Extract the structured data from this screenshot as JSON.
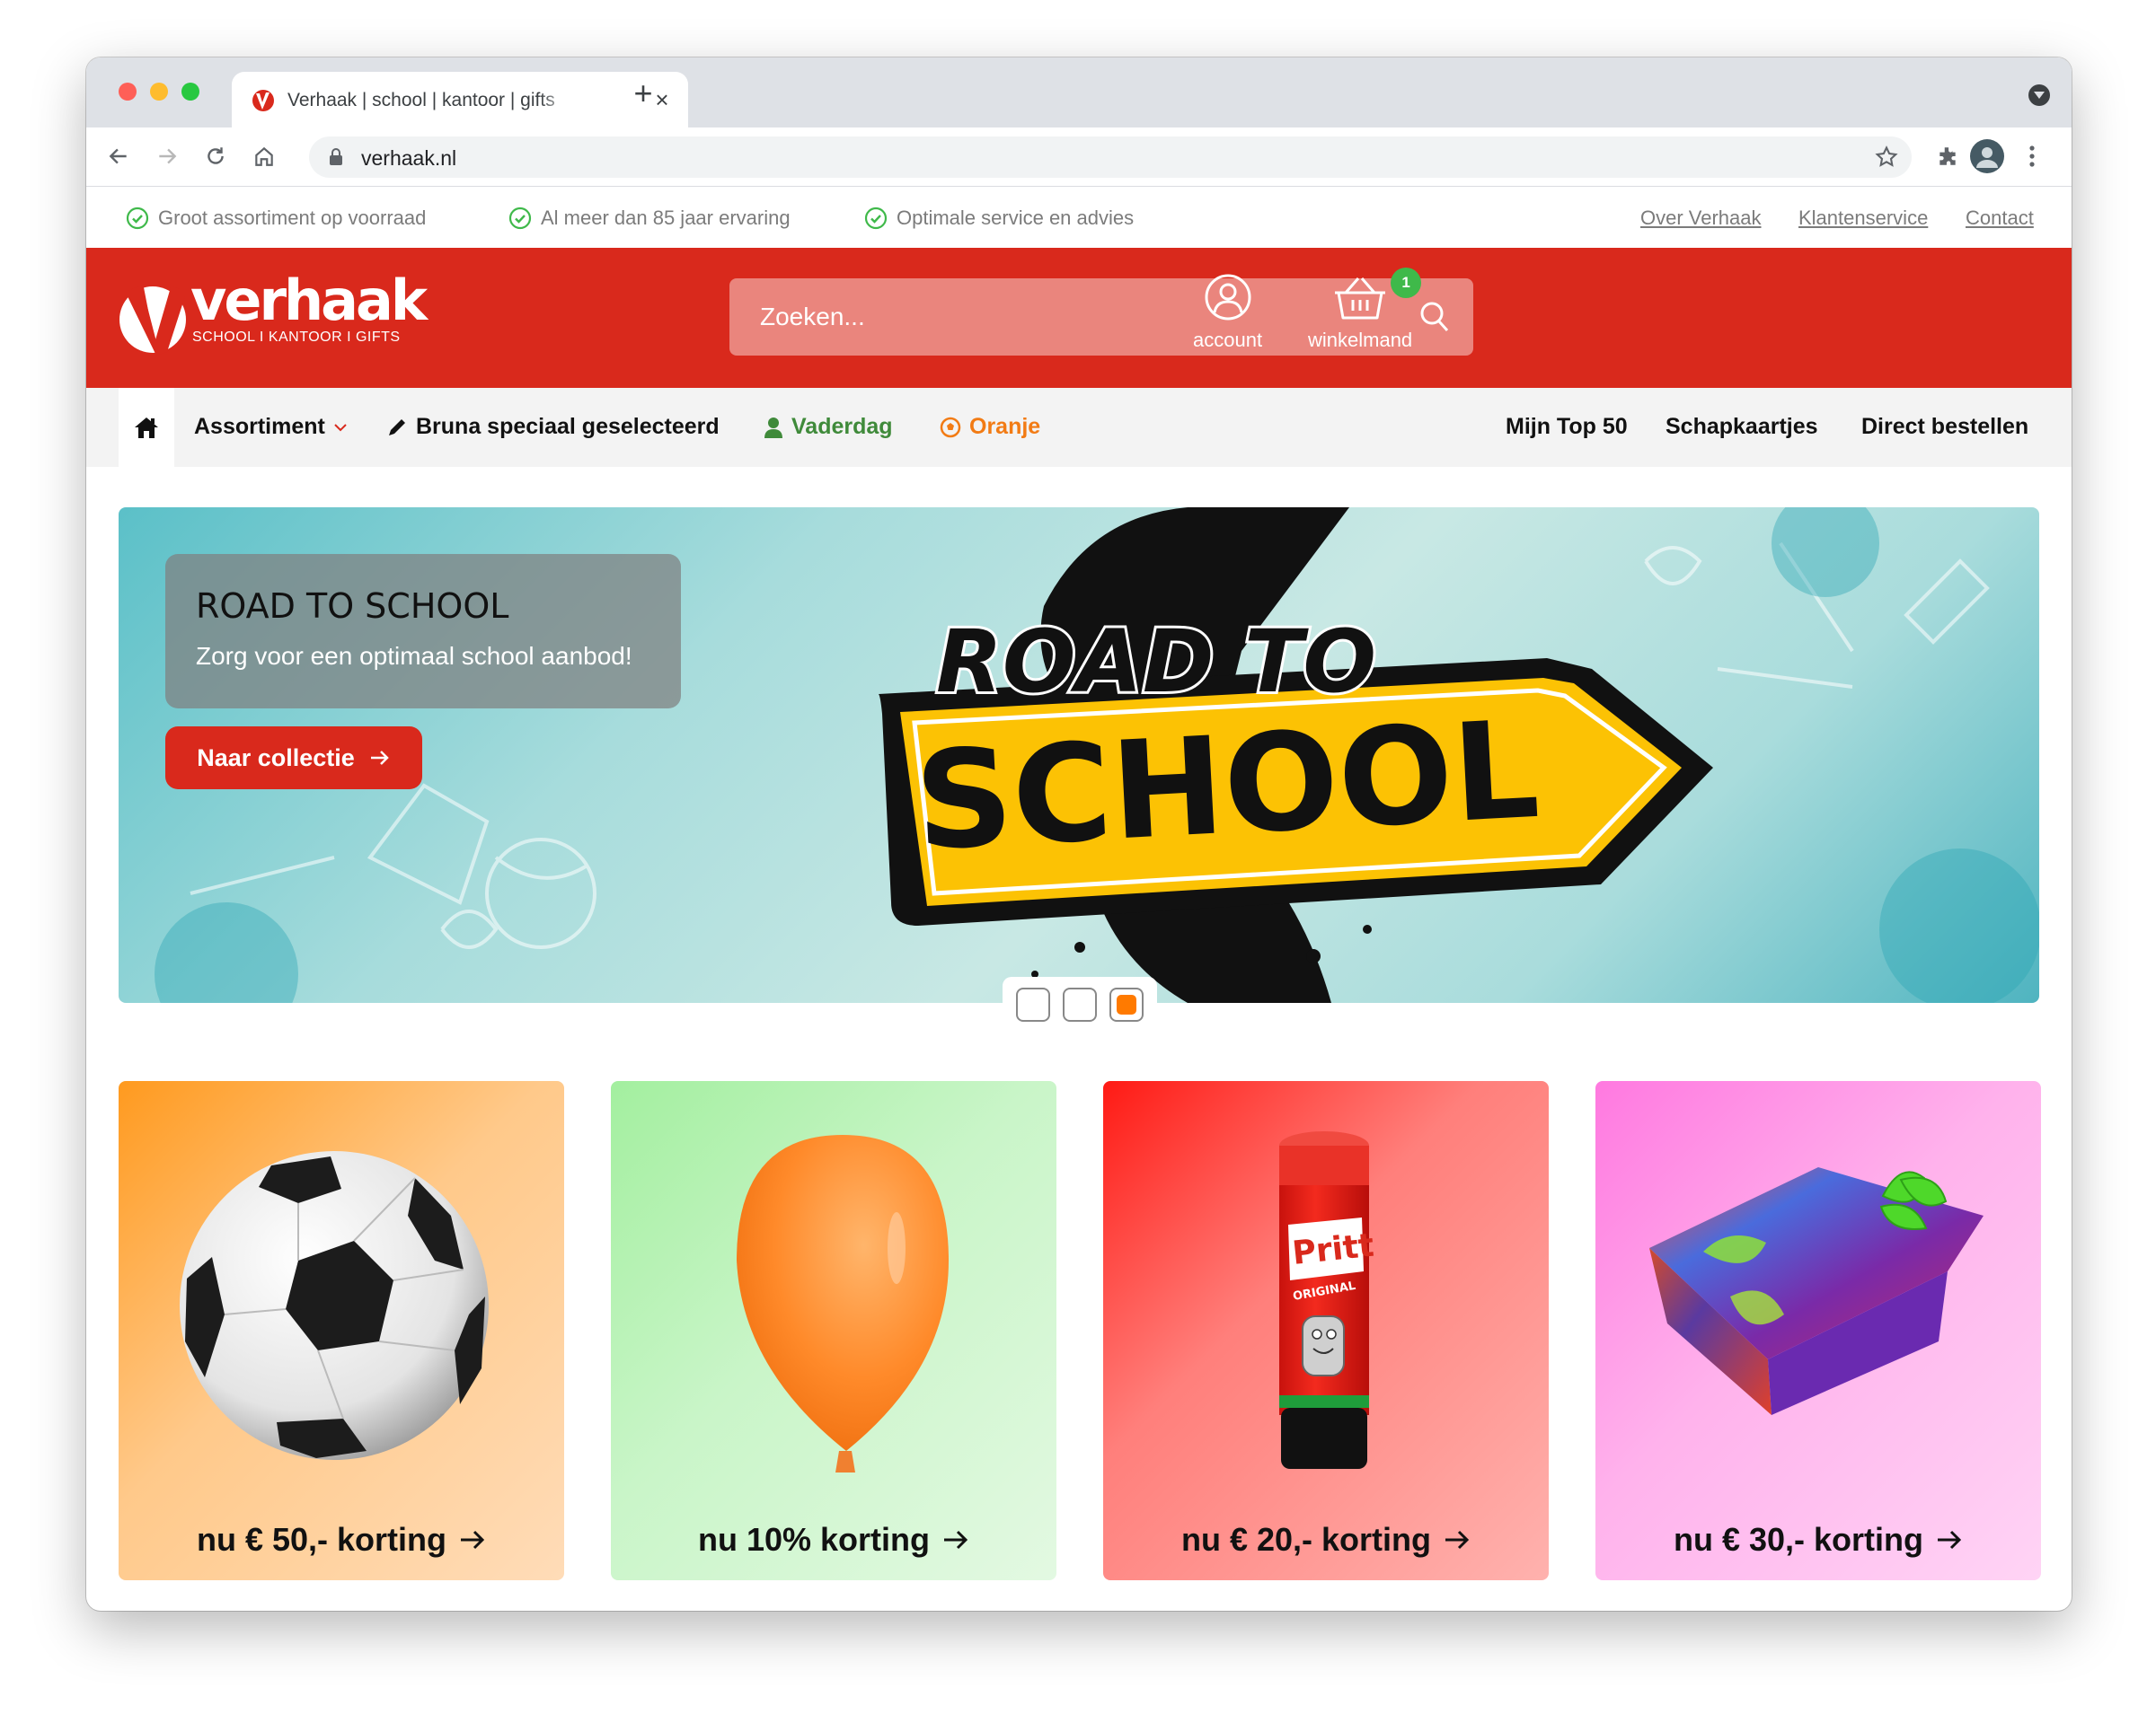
{
  "browser": {
    "tab_title": "Verhaak | school | kantoor | gifts",
    "url": "verhaak.nl",
    "icons": [
      "back-icon",
      "forward-icon",
      "reload-icon",
      "home-icon",
      "lock-icon",
      "star-icon",
      "extensions-icon",
      "profile-icon",
      "menu-icon",
      "tab-overflow-icon"
    ]
  },
  "usp_bar": {
    "items": [
      {
        "icon": "check-circle-icon",
        "text": "Groot assortiment op voorraad"
      },
      {
        "icon": "check-circle-icon",
        "text": "Al meer dan 85 jaar ervaring"
      },
      {
        "icon": "check-circle-icon",
        "text": "Optimale service en advies"
      }
    ],
    "links": [
      "Over Verhaak",
      "Klantenservice",
      "Contact"
    ]
  },
  "header": {
    "logo_word": "verhaak",
    "logo_tagline": "SCHOOL I KANTOOR I GIFTS",
    "search_placeholder": "Zoeken...",
    "account_label": "account",
    "cart_label": "winkelmand",
    "cart_count": "1",
    "brand_color": "#d9291c"
  },
  "nav": {
    "home_icon": "home-icon",
    "items": [
      {
        "label": "Assortiment",
        "icon": "chevron-down-icon"
      },
      {
        "label": "Bruna speciaal geselecteerd",
        "icon": "pencil-icon"
      },
      {
        "label": "Vaderdag",
        "icon": "user-icon",
        "color": "#3f8a3a"
      },
      {
        "label": "Oranje",
        "icon": "soccer-ball-icon",
        "color": "#f27b14"
      }
    ],
    "right_items": [
      "Mijn Top 50",
      "Schapkaartjes",
      "Direct bestellen"
    ]
  },
  "hero": {
    "title": "ROAD TO SCHOOL",
    "subtitle": "Zorg voor een optimaal school aanbod!",
    "cta_label": "Naar collectie",
    "art_line1": "ROAD TO",
    "art_line2": "SCHOOL",
    "slides_total": 3,
    "active_slide": 3
  },
  "promo_cards": [
    {
      "label": "nu € 50,- korting",
      "image": "soccer-ball"
    },
    {
      "label": "nu 10% korting",
      "image": "orange-balloon"
    },
    {
      "label": "nu € 20,- korting",
      "image": "pritt-glue-stick",
      "brand": "Pritt",
      "brand_sub": "ORIGINAL"
    },
    {
      "label": "nu € 30,- korting",
      "image": "wrapped-gift"
    }
  ]
}
